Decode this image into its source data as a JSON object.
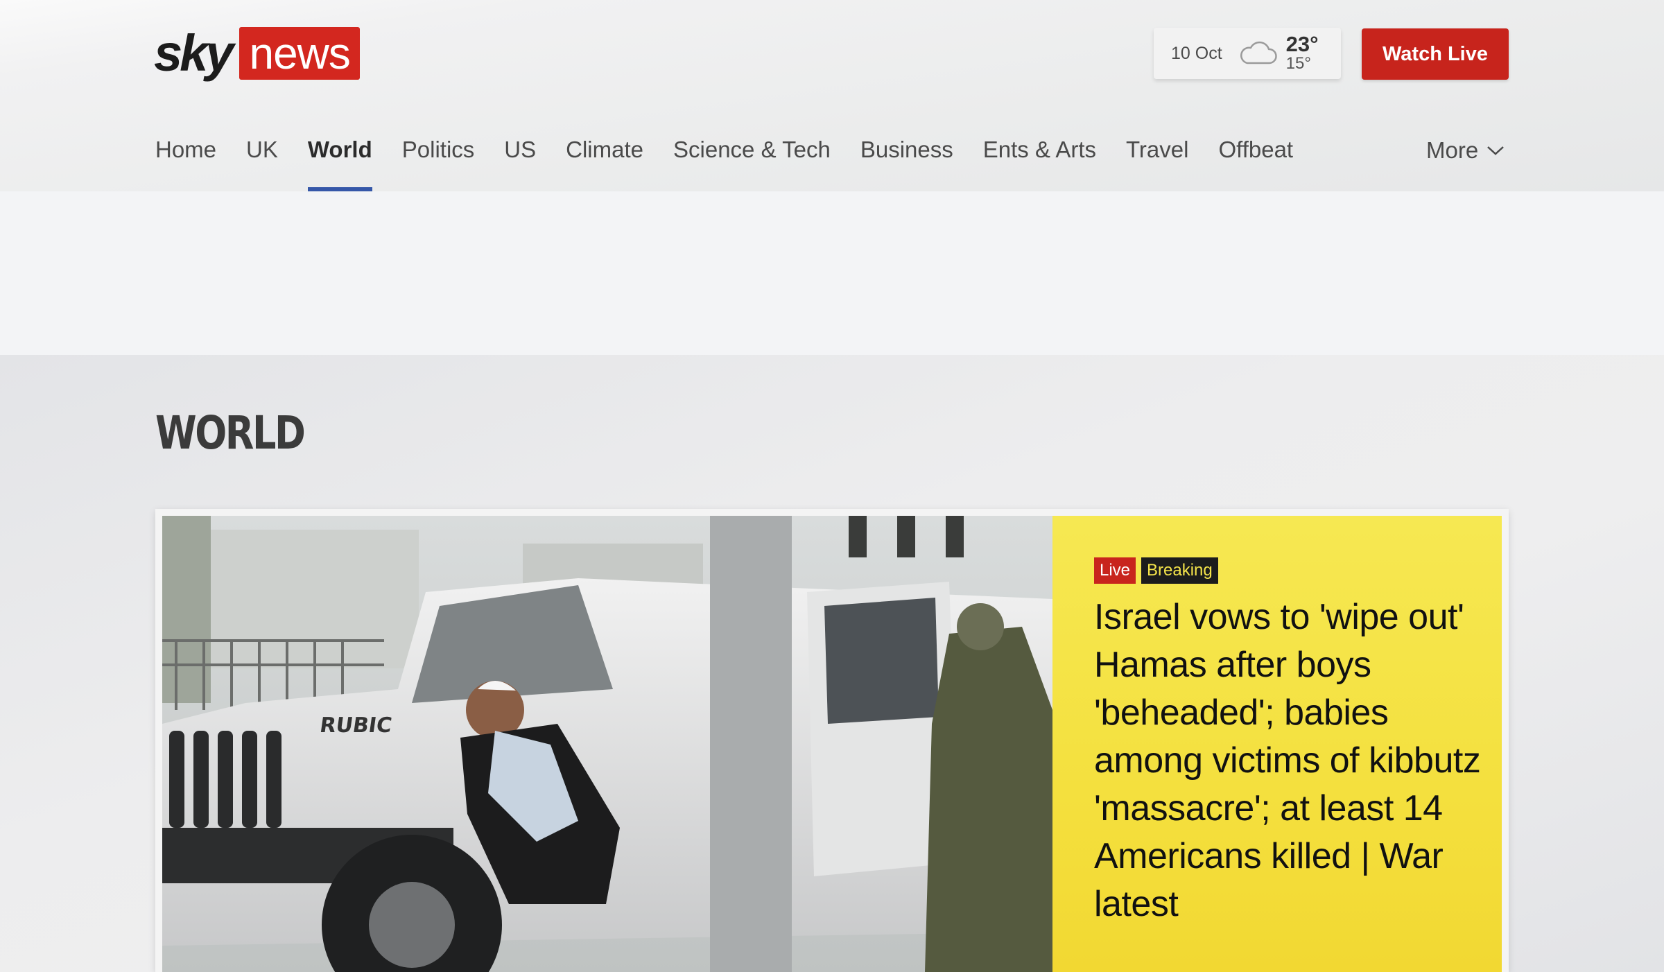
{
  "header": {
    "logo": {
      "sky": "sky",
      "news": "news"
    },
    "weather": {
      "date": "10 Oct",
      "high": "23°",
      "low": "15°",
      "icon": "cloud-icon"
    },
    "watch_live": "Watch Live"
  },
  "nav": {
    "items": [
      {
        "label": "Home"
      },
      {
        "label": "UK"
      },
      {
        "label": "World",
        "active": true
      },
      {
        "label": "Politics"
      },
      {
        "label": "US"
      },
      {
        "label": "Climate"
      },
      {
        "label": "Science & Tech"
      },
      {
        "label": "Business"
      },
      {
        "label": "Ents & Arts"
      },
      {
        "label": "Travel"
      },
      {
        "label": "Offbeat"
      }
    ],
    "more": "More"
  },
  "main": {
    "section_title": "WORLD",
    "hero": {
      "badge_live": "Live",
      "badge_breaking": "Breaking",
      "headline": "Israel vows to 'wipe out' Hamas after boys 'beheaded'; babies among victims of kibbutz 'massacre'; at least 14 Americans killed | War latest"
    }
  },
  "colors": {
    "brand_red": "#d3271f",
    "watch_live_red": "#c7241c",
    "nav_active_underline": "#3557a8",
    "headline_panel_yellow": "#f4e03e"
  }
}
